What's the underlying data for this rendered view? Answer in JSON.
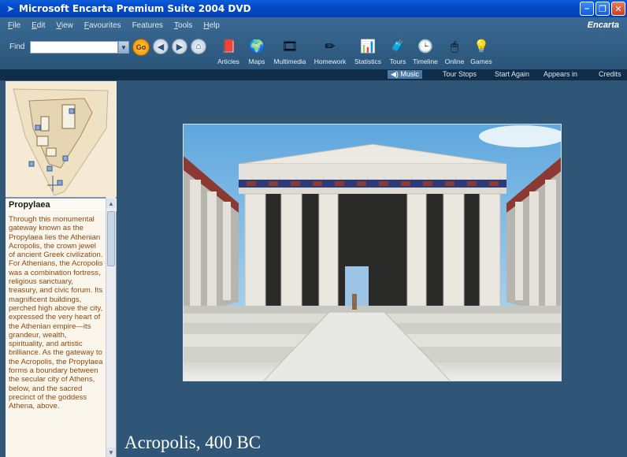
{
  "window": {
    "title": "Microsoft Encarta Premium Suite 2004 DVD",
    "min_glyph": "–",
    "max_glyph": "❐",
    "close_glyph": "✕"
  },
  "menu": {
    "items": [
      {
        "label": "File",
        "key": "F",
        "rest": "ile"
      },
      {
        "label": "Edit",
        "key": "E",
        "rest": "dit"
      },
      {
        "label": "View",
        "key": "V",
        "rest": "iew"
      },
      {
        "label": "Favourites",
        "key": "F",
        "rest": "avourites"
      },
      {
        "label": "Features",
        "key": "",
        "rest": "Features"
      },
      {
        "label": "Tools",
        "key": "T",
        "rest": "ools"
      },
      {
        "label": "Help",
        "key": "H",
        "rest": "elp"
      }
    ],
    "brand": "Encarta"
  },
  "find": {
    "label": "Find",
    "value": "",
    "go_label": "Go"
  },
  "toolbar": {
    "items": [
      {
        "label": "Articles",
        "icon": "book-icon",
        "glyph": "📕"
      },
      {
        "label": "Maps",
        "icon": "globe-icon",
        "glyph": "🌍"
      },
      {
        "label": "Multimedia",
        "icon": "multimedia-icon",
        "glyph": "🎞"
      },
      {
        "label": "Homework",
        "icon": "pencil-icon",
        "glyph": "✏"
      },
      {
        "label": "Statistics",
        "icon": "chart-icon",
        "glyph": "📊"
      },
      {
        "label": "Tours",
        "icon": "tours-icon",
        "glyph": "🧳"
      },
      {
        "label": "Timeline",
        "icon": "clock-icon",
        "glyph": "🕒"
      },
      {
        "label": "Online",
        "icon": "mouse-icon",
        "glyph": "🖱"
      },
      {
        "label": "Games",
        "icon": "bulb-icon",
        "glyph": "💡"
      }
    ]
  },
  "subbar": {
    "music": "◀) Music",
    "tour_stops": "Tour Stops",
    "start_again": "Start Again",
    "appears_in": "Appears in",
    "credits": "Credits"
  },
  "panel": {
    "title": "Propylaea",
    "text": "Through this monumental gateway known as the Propylaea lies the Athenian Acropolis, the crown jewel of ancient Greek civilization. For Athenians, the Acropolis was a combination fortress, religious sanctuary, treasury, and civic forum. Its magnificent buildings, perched high above the city, expressed the very heart of the Athenian empire—its grandeur, wealth, spirituality, and artistic brilliance. As the gateway to the Acropolis, the Propylaea forms a boundary between the secular city of Athens, below, and the sacred precinct of the goddess Athena, above."
  },
  "main": {
    "caption": "Acropolis, 400 BC"
  },
  "colors": {
    "title_bar": "#0448c6",
    "background": "#2f5577",
    "panel_text": "#8a4a12"
  }
}
